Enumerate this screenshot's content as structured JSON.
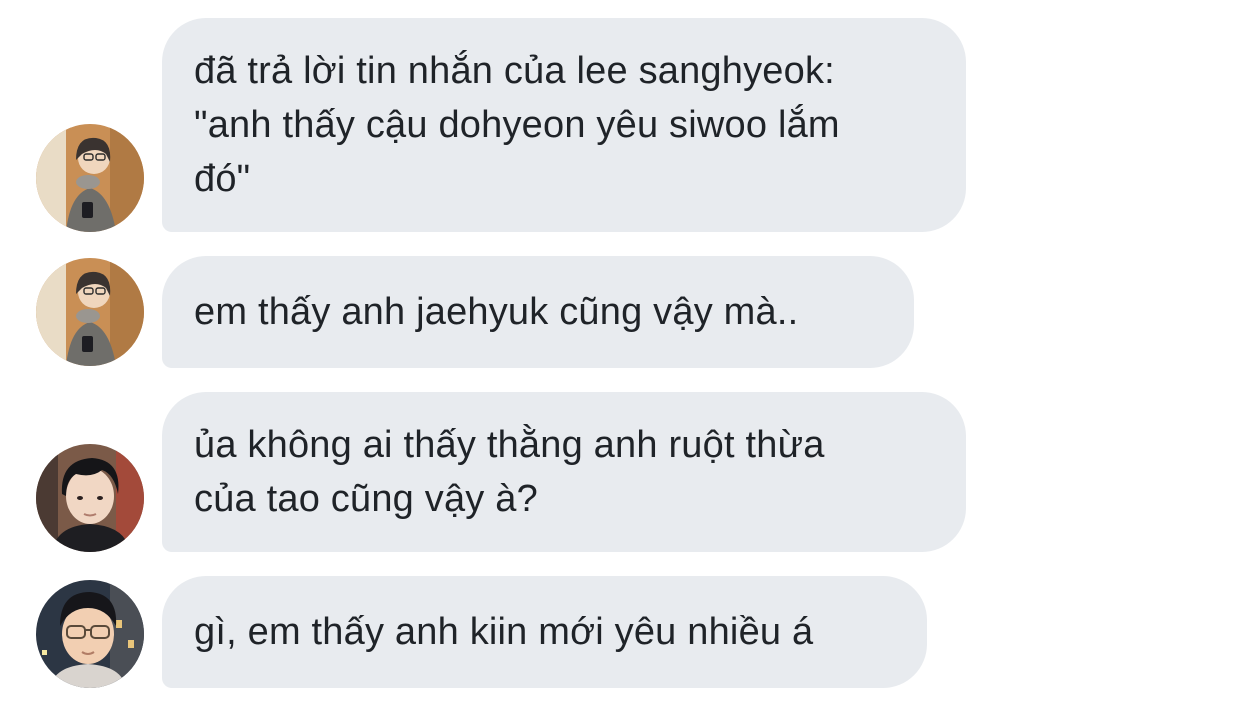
{
  "messages": [
    {
      "sender": "user-a",
      "text": "đã trả lời tin nhắn của lee sanghyeok:\n\"anh thấy cậu dohyeon yêu siwoo lắm\nđó\""
    },
    {
      "sender": "user-a",
      "text": "em thấy anh jaehyuk cũng vậy mà.."
    },
    {
      "sender": "user-b",
      "text": "ủa không ai thấy thằng anh ruột thừa\ncủa tao cũng vậy à?"
    },
    {
      "sender": "user-c",
      "text": "gì, em thấy anh kiin mới yêu nhiều á"
    }
  ]
}
